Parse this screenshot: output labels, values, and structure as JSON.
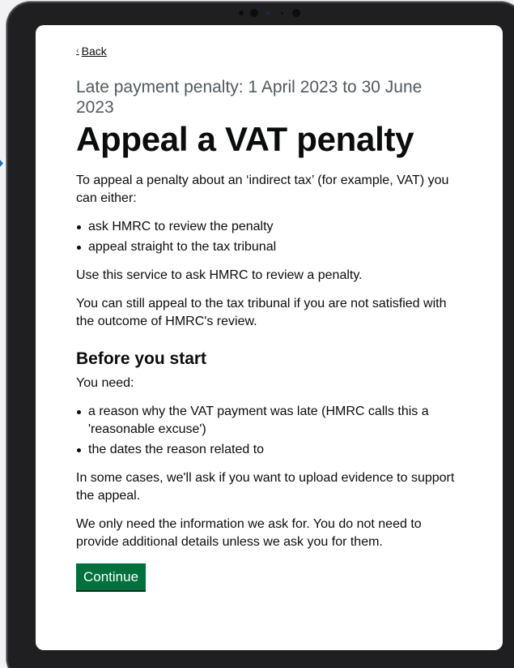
{
  "nav": {
    "back_label": "Back"
  },
  "header": {
    "caption": "Late payment penalty: 1 April 2023 to 30 June 2023",
    "title": "Appeal a VAT penalty"
  },
  "intro": {
    "paragraph": "To appeal a penalty about an ‘indirect tax’ (for example, VAT) you can either:",
    "options": [
      "ask HMRC to review the penalty",
      "appeal straight to the tax tribunal"
    ],
    "service_note": "Use this service to ask HMRC to review a penalty.",
    "tribunal_note": "You can still appeal to the tax tribunal if you are not satisfied with the outcome of HMRC's review."
  },
  "before_you_start": {
    "heading": "Before you start",
    "lead": "You need:",
    "needs": [
      "a reason why the VAT payment was late (HMRC calls this a 'reasonable excuse')",
      "the dates the reason related to"
    ],
    "evidence_note": "In some cases, we'll ask if you want to upload evidence to support the appeal.",
    "info_note": "We only need the information we ask for. You do not need to provide additional details unless we ask you for them."
  },
  "actions": {
    "continue_label": "Continue"
  },
  "colors": {
    "button_green": "#00703c",
    "caption_grey": "#505a5f",
    "text": "#0b0c0c"
  },
  "icons": {
    "back": "chevron-left-icon"
  }
}
